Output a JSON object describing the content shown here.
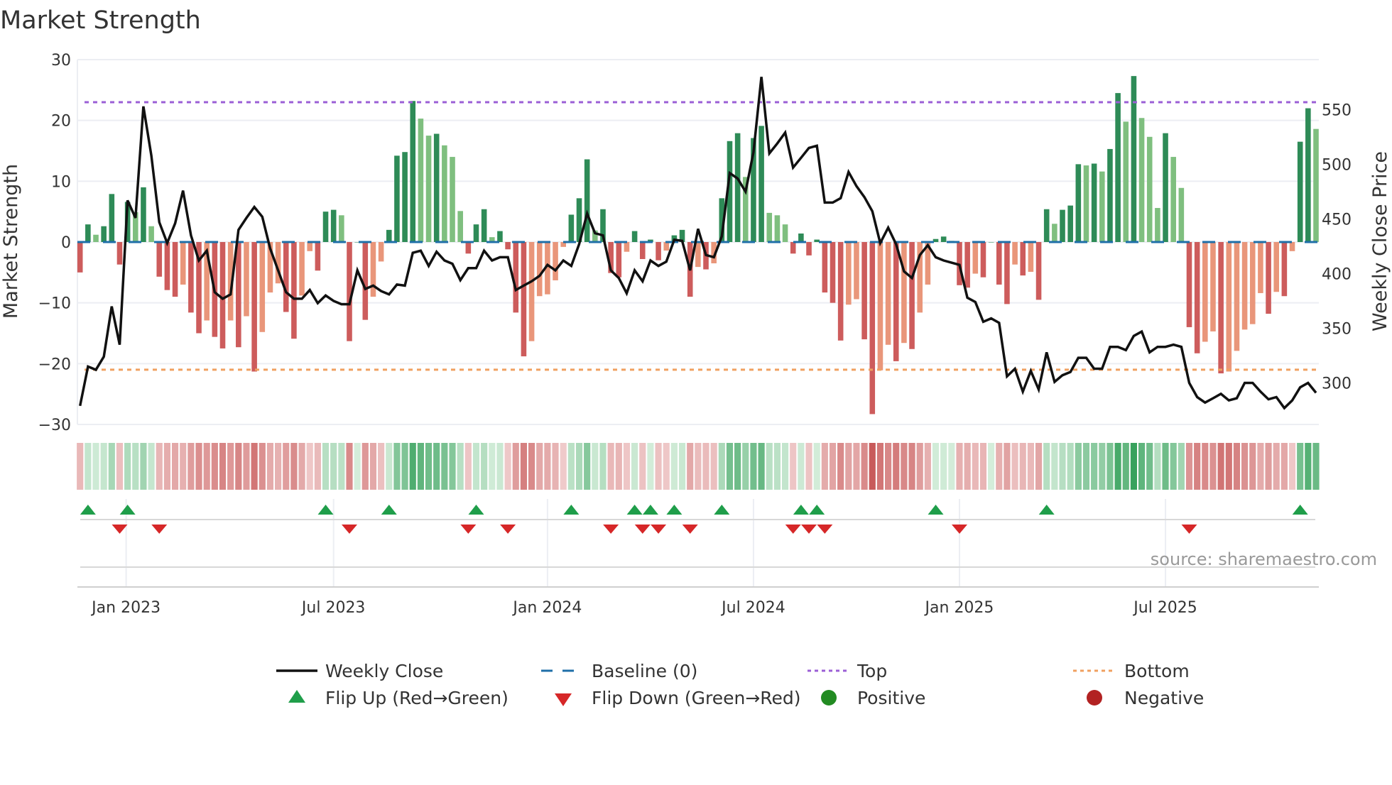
{
  "chart_data": {
    "type": "bar",
    "title": "Market Strength",
    "ylabel": "Market Strength",
    "y2label": "Weekly Close Price",
    "ylim": [
      -30,
      30
    ],
    "y2lim": [
      255,
      590
    ],
    "yticks": [
      "30",
      "20",
      "10",
      "0",
      "−10",
      "−20",
      "−30"
    ],
    "ytick_values": [
      30,
      20,
      10,
      0,
      -10,
      -20,
      -30
    ],
    "y2ticks": [
      "550",
      "500",
      "450",
      "400",
      "350",
      "300"
    ],
    "y2tick_values": [
      550,
      500,
      450,
      400,
      350,
      300
    ],
    "xticks": [
      "Jan 2023",
      "Jul 2023",
      "Jan 2024",
      "Jul 2024",
      "Jan 2025",
      "Jul 2025"
    ],
    "xtick_week_index": [
      6,
      32,
      59,
      85,
      111,
      137
    ],
    "top_level": 23,
    "bottom_level": -21,
    "strength": [
      -5,
      2.9,
      1.2,
      2.6,
      7.9,
      -3.7,
      6.6,
      4.9,
      9,
      2.6,
      -5.7,
      -7.9,
      -9,
      -7,
      -11.6,
      -15,
      -12.9,
      -15.6,
      -17.5,
      -12.9,
      -17.3,
      -12.2,
      -21.3,
      -14.8,
      -8.3,
      -6.8,
      -11.5,
      -15.9,
      -8.8,
      -1.5,
      -4.7,
      5.0,
      5.3,
      4.4,
      -16.3,
      0,
      -12.8,
      -9,
      -3.2,
      2,
      14.2,
      14.8,
      23.2,
      20.3,
      17.5,
      17.8,
      15.9,
      14,
      5.1,
      -1.9,
      2.9,
      5.4,
      0.8,
      1.8,
      -1.2,
      -11.6,
      -18.8,
      -16.3,
      -8.9,
      -8.6,
      -6.3,
      -0.8,
      4.5,
      7.2,
      13.6,
      1.9,
      5.4,
      -5.1,
      -5.8,
      -1.6,
      1.8,
      -2.8,
      0.4,
      -3,
      -1.4,
      1.1,
      2,
      -9,
      -4.1,
      -4.5,
      -3.5,
      7.2,
      16.6,
      17.9,
      10.7,
      17.1,
      19.1,
      4.8,
      4.4,
      2.9,
      -1.9,
      1.4,
      -2.2,
      0.4,
      -8.3,
      -10,
      -16.2,
      -10.3,
      -9.4,
      -16,
      -28.3,
      -21.1,
      -16.9,
      -19.6,
      -16.6,
      -17.6,
      -11.6,
      -7,
      0.5,
      0.9,
      0.2,
      -7.1,
      -7.5,
      -5.2,
      -5.8,
      0,
      -7,
      -10.2,
      -3.7,
      -5.5,
      -4.9,
      -9.5,
      5.4,
      3,
      5.3,
      6,
      12.8,
      12.6,
      12.9,
      11.6,
      15.3,
      24.5,
      19.8,
      27.3,
      20.4,
      17.3,
      5.6,
      17.9,
      14,
      8.9,
      -14,
      -18.3,
      -16.4,
      -14.7,
      -21.6,
      -21.3,
      -17.9,
      -14.4,
      -13.5,
      -8.4,
      -11.8,
      -8.2,
      -8.9,
      -1.5,
      16.5,
      22,
      18.6
    ],
    "weekly_close": [
      279,
      315,
      312,
      324,
      370,
      335,
      467,
      451,
      553,
      508,
      447,
      428,
      446,
      476,
      435,
      412,
      421,
      383,
      377,
      381,
      440,
      451,
      461,
      452,
      423,
      403,
      383,
      377,
      377,
      385,
      373,
      380,
      375,
      372,
      372,
      403,
      386,
      389,
      384,
      381,
      390,
      389,
      419,
      421,
      407,
      420,
      412,
      409,
      394,
      405,
      405,
      421,
      412,
      415,
      415,
      385,
      389,
      393,
      398,
      408,
      403,
      412,
      407,
      427,
      455,
      437,
      435,
      403,
      396,
      382,
      403,
      393,
      412,
      407,
      411,
      431,
      430,
      403,
      441,
      417,
      415,
      434,
      492,
      487,
      475,
      511,
      580,
      510,
      519,
      529,
      497,
      506,
      515,
      517,
      465,
      465,
      469,
      493,
      480,
      470,
      457,
      428,
      442,
      427,
      402,
      396,
      417,
      426,
      415,
      412,
      410,
      408,
      378,
      374,
      356,
      359,
      355,
      306,
      313,
      292,
      311,
      294,
      328,
      301,
      307,
      310,
      323,
      323,
      313,
      313,
      333,
      333,
      330,
      343,
      347,
      328,
      333,
      333,
      335,
      333,
      300,
      287,
      282,
      286,
      290,
      284,
      286,
      300,
      300,
      292,
      285,
      287,
      277,
      284,
      296,
      300,
      291
    ],
    "flip_up_index": [
      1,
      6,
      31,
      39,
      50,
      62,
      70,
      72,
      75,
      81,
      91,
      93,
      108,
      122,
      154
    ],
    "flip_down_index": [
      5,
      10,
      34,
      49,
      54,
      67,
      71,
      73,
      77,
      90,
      92,
      94,
      111,
      140
    ],
    "legend": {
      "weekly_close": "Weekly Close",
      "baseline": "Baseline (0)",
      "top": "Top",
      "bottom": "Bottom",
      "flip_up": "Flip Up (Red→Green)",
      "flip_down": "Flip Down (Green→Red)",
      "positive": "Positive",
      "negative": "Negative"
    },
    "legend_placement": "bottom",
    "source": "source: sharemaestro.com",
    "colors": {
      "green_dark": "#2e8b57",
      "green_light": "#7fbf7f",
      "red_dark": "#cd5c5c",
      "red_light": "#e9967a",
      "line": "#111111",
      "baseline": "#1f6fa8",
      "top": "#9b5fd6",
      "bottom": "#f0a060",
      "flip_up": "#1f9e4a",
      "flip_down": "#d62728",
      "positive": "#228b22",
      "negative": "#b22222"
    }
  }
}
